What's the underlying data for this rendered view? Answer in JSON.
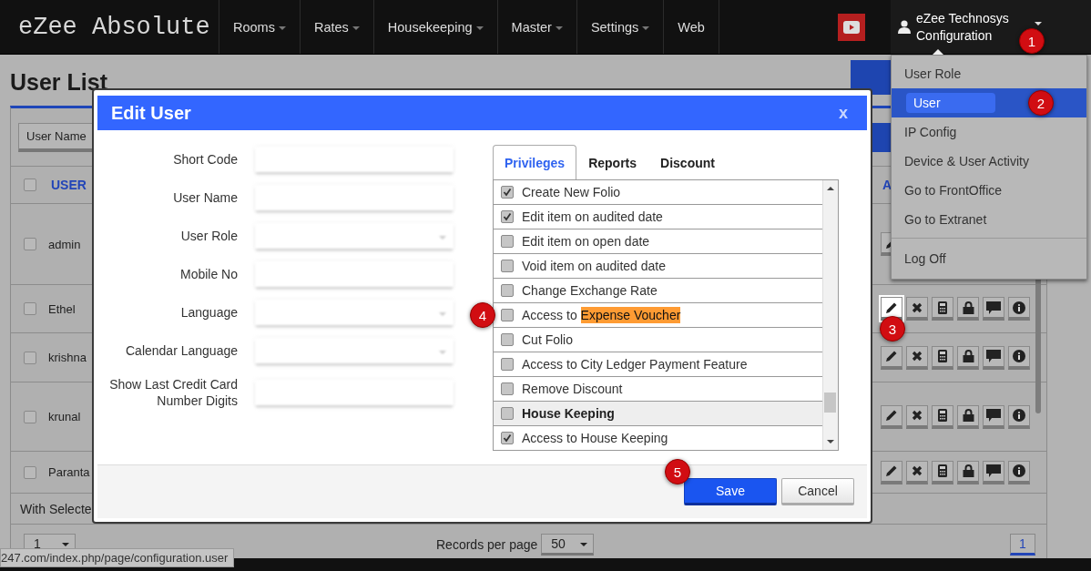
{
  "navbar": {
    "logo": "eZee Absolute",
    "menus": [
      {
        "label": "Rooms",
        "has_menu": true
      },
      {
        "label": "Rates",
        "has_menu": true
      },
      {
        "label": "Housekeeping",
        "has_menu": true
      },
      {
        "label": "Master",
        "has_menu": true
      },
      {
        "label": "Settings",
        "has_menu": true
      },
      {
        "label": "Web",
        "has_menu": false
      }
    ],
    "user": {
      "name": "eZee Technosys",
      "role": "Configuration",
      "annotation": "1"
    }
  },
  "page": {
    "title": "User List",
    "filter_button": "User Name",
    "header": {
      "checked": false,
      "column_2": "USER",
      "column_3": "A"
    },
    "rows": [
      {
        "name": "admin",
        "checked": false,
        "edit_focused": false,
        "covered_by_menu": true
      },
      {
        "name": "Ethel",
        "checked": false,
        "edit_focused": true,
        "covered_by_menu": false,
        "annotation": "3"
      },
      {
        "name": "krishna",
        "checked": false,
        "edit_focused": false,
        "covered_by_menu": false
      },
      {
        "name": "krunal",
        "checked": false,
        "edit_focused": false,
        "covered_by_menu": false
      },
      {
        "name": "Paranta",
        "checked": false,
        "edit_focused": false,
        "covered_by_menu": false
      }
    ],
    "bulk_label": "With Selecte",
    "page_select": "1",
    "records_label": "Records per page",
    "records_select": "50",
    "pager": [
      {
        "label": "1",
        "selected": true
      }
    ]
  },
  "status_url": "247.com/index.php/page/configuration.user",
  "user_menu": {
    "items": [
      {
        "label": "User Role",
        "selected": false
      },
      {
        "label": "User",
        "selected": true,
        "annotation": "2"
      },
      {
        "label": "IP Config",
        "selected": false
      },
      {
        "label": "Device & User Activity",
        "selected": false
      },
      {
        "label": "Go to FrontOffice",
        "selected": false
      },
      {
        "label": "Go to Extranet",
        "selected": false
      }
    ],
    "footer_items": [
      "Log Off"
    ]
  },
  "dialog": {
    "title": "Edit User",
    "close": "x",
    "fields": [
      {
        "label": "Short Code",
        "kind": "text"
      },
      {
        "label": "User Name",
        "kind": "text"
      },
      {
        "label": "User Role",
        "kind": "select"
      },
      {
        "label": "Mobile No",
        "kind": "text"
      },
      {
        "label": "Language",
        "kind": "select"
      },
      {
        "label": "Calendar Language",
        "kind": "select"
      },
      {
        "label": "Show Last Credit Card Number Digits",
        "kind": "text"
      }
    ],
    "tabs": [
      {
        "label": "Privileges",
        "selected": true
      },
      {
        "label": "Reports",
        "selected": false
      },
      {
        "label": "Discount",
        "selected": false
      }
    ],
    "privileges": [
      {
        "label": "Create New Folio",
        "checked": true,
        "kind": "item"
      },
      {
        "label": "Edit item on audited date",
        "checked": true,
        "kind": "item"
      },
      {
        "label": "Edit item on open date",
        "checked": false,
        "kind": "item"
      },
      {
        "label": "Void item on audited date",
        "checked": false,
        "kind": "item"
      },
      {
        "label": "Change Exchange Rate",
        "checked": false,
        "kind": "item"
      },
      {
        "label": "Access to",
        "highlight": "Expense Voucher",
        "checked": false,
        "kind": "item",
        "annotation": "4"
      },
      {
        "label": "Cut Folio",
        "checked": false,
        "kind": "item"
      },
      {
        "label": "Access to City Ledger Payment Feature",
        "checked": false,
        "kind": "item"
      },
      {
        "label": "Remove Discount",
        "checked": false,
        "kind": "item"
      },
      {
        "label": "House Keeping",
        "checked": false,
        "kind": "group"
      },
      {
        "label": "Access to House Keeping",
        "checked": true,
        "kind": "item"
      }
    ],
    "buttons": [
      {
        "label": "Save",
        "kind": "primary",
        "annotation": "5"
      },
      {
        "label": "Cancel",
        "kind": "secondary"
      }
    ]
  }
}
